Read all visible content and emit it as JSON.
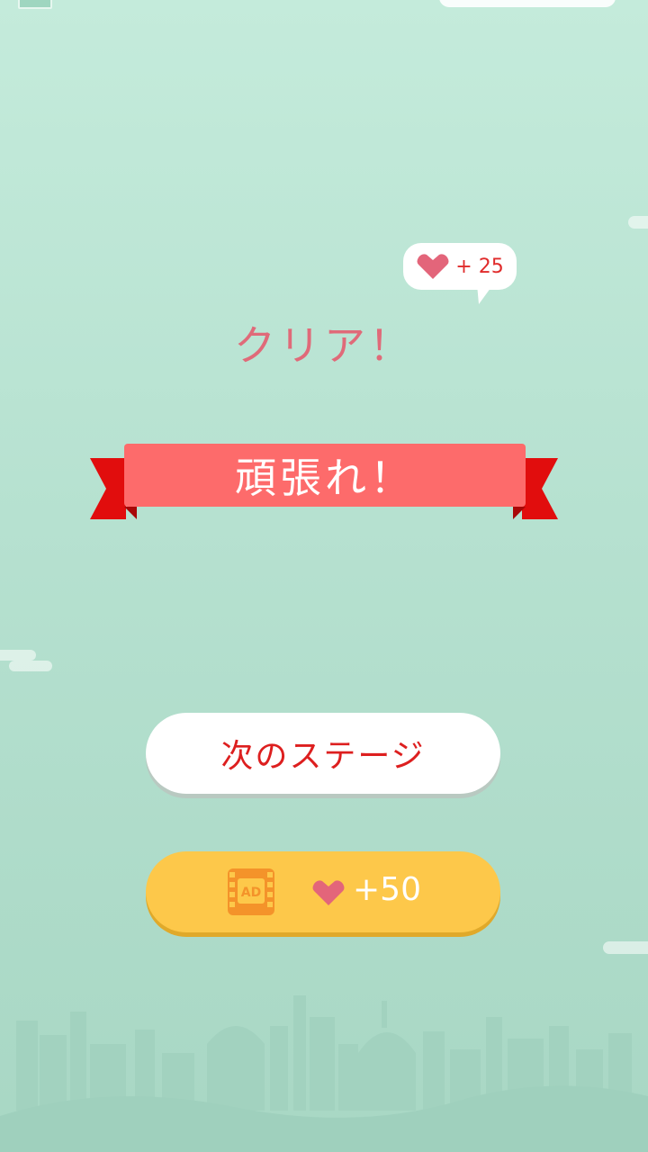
{
  "reward_bubble": {
    "text": "+ 25",
    "icon": "heart-icon"
  },
  "title": "クリア！",
  "banner": {
    "text": "頑張れ！"
  },
  "buttons": {
    "next_stage": "次のステージ",
    "ad_icon_text": "AD",
    "ad_reward": "+50"
  },
  "colors": {
    "title": "#e06a79",
    "banner": "#fd6b6b",
    "banner_tails": "#e10d0d",
    "heart": "#e3657a",
    "next_label": "#dd1f1f",
    "ad_button": "#fdc84a"
  }
}
